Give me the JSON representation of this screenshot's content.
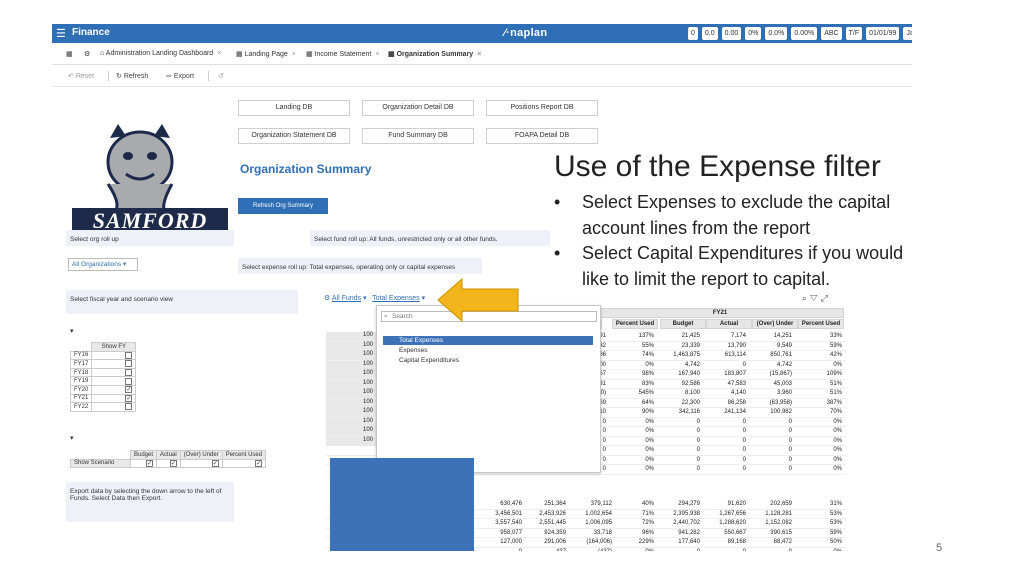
{
  "app": {
    "title": "Finance",
    "brand": "naplan",
    "chips": [
      "0",
      "0.0",
      "0.00",
      "0%",
      "0.0%",
      "0.00%",
      "ABC",
      "T/F",
      "01/01/99",
      "Jan"
    ]
  },
  "tabs": [
    {
      "label": "Administration Landing Dashboard"
    },
    {
      "label": "Landing Page"
    },
    {
      "label": "Income Statement"
    },
    {
      "label": "Organization Summary"
    }
  ],
  "toolbar": {
    "reset": "Reset",
    "refresh": "Refresh",
    "export": "Export"
  },
  "nav_buttons": [
    "Landing DB",
    "Organization Detail DB",
    "Positions Report DB",
    "Organization Statement DB",
    "Fund Summary DB",
    "FOAPA Detail DB"
  ],
  "logo_text": "SAMFORD",
  "org_title": "Organization Summary",
  "refresh_org": "Refresh Org Summary",
  "labels": {
    "org_rollup": "Select org roll up",
    "fund_rollup": "Select fund roll up: All funds, unrestricted only or all other funds.",
    "expense_rollup": "Select expense roll up: Total expenses, operating only or capital expenses",
    "fiscal_year": "Select fiscal year and scenario view",
    "export_note": "Export data by selecting the down arrow to the left of Funds. Select Data then Export."
  },
  "org_dropdown": "All Organizations",
  "fy_table": {
    "header": "Show FY",
    "rows": [
      {
        "label": "FY16",
        "checked": false
      },
      {
        "label": "FY17",
        "checked": false
      },
      {
        "label": "FY18",
        "checked": false
      },
      {
        "label": "FY19",
        "checked": false
      },
      {
        "label": "FY20",
        "checked": true
      },
      {
        "label": "FY21",
        "checked": true
      },
      {
        "label": "FY22",
        "checked": false
      }
    ]
  },
  "scenario_table": {
    "headers": [
      "Budget",
      "Actual",
      "(Over) Under",
      "Percent Used"
    ],
    "row_label": "Show Scenario"
  },
  "filters": {
    "funds": "All Funds",
    "expenses": "Total Expenses"
  },
  "popup": {
    "search_placeholder": "Search",
    "items": [
      "Total Expenses",
      "Expenses",
      "Capital Expenditures"
    ]
  },
  "grid": {
    "fy_label": "FY21",
    "left_headers": [
      "er",
      "Percent Used"
    ],
    "right_headers": [
      "Budget",
      "Actual",
      "(Over) Under",
      "Percent Used"
    ],
    "id_label": "100",
    "top_rows": [
      [
        "91",
        "137%",
        "21,425",
        "7,174",
        "14,251",
        "33%"
      ],
      [
        "932",
        "55%",
        "23,339",
        "13,790",
        "9,549",
        "59%"
      ],
      [
        "386",
        "74%",
        "1,463,875",
        "613,114",
        "850,761",
        "42%"
      ],
      [
        "600",
        "0%",
        "4,742",
        "0",
        "4,742",
        "0%"
      ],
      [
        "167",
        "98%",
        "167,940",
        "183,807",
        "(15,867)",
        "109%"
      ],
      [
        "031",
        "83%",
        "92,586",
        "47,583",
        "45,003",
        "51%"
      ],
      [
        "20)",
        "545%",
        "8,100",
        "4,140",
        "3,960",
        "51%"
      ],
      [
        "769",
        "64%",
        "22,300",
        "86,258",
        "(63,958)",
        "387%"
      ],
      [
        "310",
        "90%",
        "342,116",
        "241,134",
        "100,982",
        "70%"
      ],
      [
        "0",
        "0%",
        "0",
        "0",
        "0",
        "0%"
      ],
      [
        "0",
        "0%",
        "0",
        "0",
        "0",
        "0%"
      ],
      [
        "0",
        "0%",
        "0",
        "0",
        "0",
        "0%"
      ],
      [
        "0",
        "0%",
        "0",
        "0",
        "0",
        "0%"
      ],
      [
        "0",
        "0%",
        "0",
        "0",
        "0",
        "0%"
      ],
      [
        "0",
        "0%",
        "0",
        "0",
        "0",
        "0%"
      ]
    ],
    "bottom_rows": [
      [
        "630,476",
        "251,364",
        "379,112",
        "40%",
        "294,279",
        "91,620",
        "202,659",
        "31%"
      ],
      [
        "3,456,501",
        "2,453,926",
        "1,002,654",
        "71%",
        "2,395,938",
        "1,267,656",
        "1,128,281",
        "53%"
      ],
      [
        "3,557,540",
        "2,551,445",
        "1,006,095",
        "72%",
        "2,440,702",
        "1,288,620",
        "1,152,082",
        "53%"
      ],
      [
        "958,077",
        "924,359",
        "33,718",
        "96%",
        "941,282",
        "550,667",
        "390,615",
        "59%"
      ],
      [
        "127,000",
        "291,006",
        "(164,006)",
        "229%",
        "177,640",
        "89,168",
        "88,472",
        "50%"
      ],
      [
        "0",
        "437",
        "(437)",
        "0%",
        "0",
        "0",
        "0",
        "0%"
      ],
      [
        "165,420",
        "163,671",
        "1,749",
        "99%",
        "164,835",
        "91,854",
        "72,980",
        "56%"
      ],
      [
        "550,414",
        "508,641",
        "41,773",
        "92%",
        "511,605",
        "189,386",
        "322,219",
        "37%"
      ]
    ]
  },
  "slide": {
    "title": "Use of the Expense filter",
    "bullets": [
      "Select Expenses to exclude the capital account lines from the report",
      "Select Capital Expenditures if you would like to limit the report to capital."
    ],
    "page": "5"
  },
  "colors": {
    "accent": "#2f6fb5",
    "arrow": "#f2b51c",
    "selection": "#3d72b8"
  }
}
